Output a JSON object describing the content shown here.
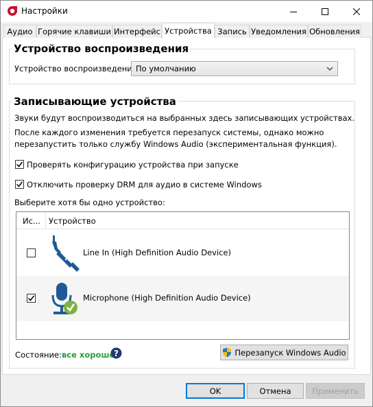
{
  "window": {
    "title": "Настройки"
  },
  "tabs": [
    {
      "label": "Аудио"
    },
    {
      "label": "Горячие клавиши"
    },
    {
      "label": "Интерфейс"
    },
    {
      "label": "Устройства",
      "active": true
    },
    {
      "label": "Запись"
    },
    {
      "label": "Уведомления"
    },
    {
      "label": "Обновления"
    }
  ],
  "playback": {
    "title": "Устройство воспроизведения",
    "label": "Устройство воспроизведения:",
    "selected": "По умолчанию"
  },
  "recording": {
    "title": "Записывающие устройства",
    "info1": "Звуки будут воспроизводиться на выбранных здесь записывающих устройствах.",
    "info2_line1": "После каждого изменения требуется перезапуск системы, однако можно",
    "info2_line2": "перезапустить только службу Windows Audio (экспериментальная функция).",
    "check_config_label": "Проверять конфигурацию устройства при запуске",
    "check_config_checked": true,
    "disable_drm_label": "Отключить проверку DRM для аудио в системе Windows",
    "disable_drm_checked": true,
    "select_prompt": "Выберите хотя бы одно устройство:",
    "columns": [
      "Ис...",
      "Устройство"
    ],
    "devices": [
      {
        "name": "Line In (High Definition Audio Device)",
        "checked": false,
        "icon": "line-in-jack-icon"
      },
      {
        "name": "Microphone (High Definition Audio Device)",
        "checked": true,
        "icon": "microphone-icon"
      }
    ],
    "status_label": "Состояние:",
    "status_value": "все хорошо",
    "restart_button": "Перезапуск Windows Audio"
  },
  "footer": {
    "ok": "OK",
    "cancel": "Отмена",
    "apply": "Применить"
  },
  "colors": {
    "accent": "#0078d7",
    "status_ok": "#2a9d3a",
    "icon_blue": "#1f5a96"
  }
}
